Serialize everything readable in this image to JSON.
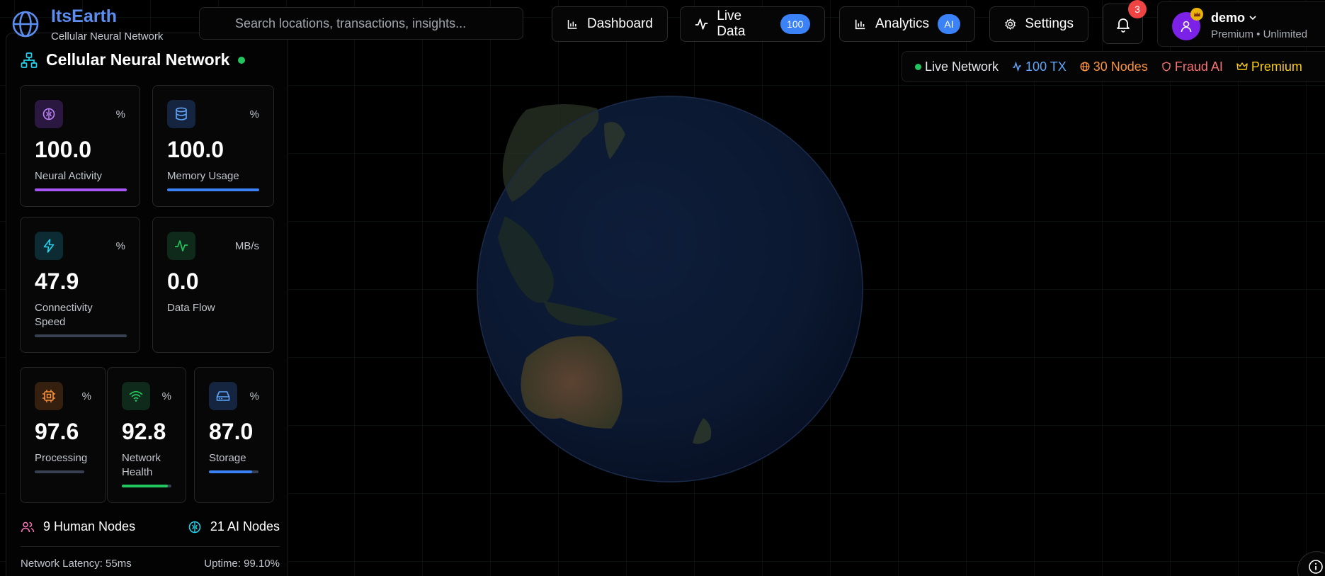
{
  "brand": {
    "title": "ItsEarth",
    "subtitle": "Cellular Neural Network"
  },
  "search": {
    "placeholder": "Search locations, transactions, insights..."
  },
  "nav": {
    "dashboard": "Dashboard",
    "live_data": {
      "label": "Live Data",
      "badge": "100"
    },
    "analytics": {
      "label": "Analytics",
      "badge": "AI"
    },
    "settings": "Settings"
  },
  "notifications": {
    "count": "3"
  },
  "user": {
    "name": "demo",
    "plan": "Premium • Unlimited"
  },
  "sidebar": {
    "title": "Cellular Neural Network",
    "cards": [
      {
        "value": "100.0",
        "unit": "%",
        "label": "Neural Activity",
        "level": 1.0,
        "color": "#a855f7",
        "icon": "brain-icon"
      },
      {
        "value": "100.0",
        "unit": "%",
        "label": "Memory Usage",
        "level": 1.0,
        "color": "#3b82f6",
        "icon": "database-icon"
      },
      {
        "value": "47.9",
        "unit": "%",
        "label": "Connectivity Speed",
        "level": 0.0,
        "color": "#22d3ee",
        "icon": "zap-icon"
      },
      {
        "value": "0.0",
        "unit": "MB/s",
        "label": "Data Flow",
        "level": 0.0,
        "color": "#22c55e",
        "icon": "activity-icon"
      },
      {
        "value": "97.6",
        "unit": "%",
        "label": "Processing",
        "level": 0.0,
        "color": "#f97316",
        "icon": "cpu-icon"
      },
      {
        "value": "92.8",
        "unit": "%",
        "label": "Network Health",
        "level": 0.928,
        "color": "#22c55e",
        "icon": "wifi-icon"
      },
      {
        "value": "87.0",
        "unit": "%",
        "label": "Storage",
        "level": 0.87,
        "color": "#3b82f6",
        "icon": "hard-drive-icon"
      }
    ],
    "human_nodes": "9 Human Nodes",
    "ai_nodes": "21 AI Nodes",
    "latency": "Network Latency: 55ms",
    "uptime": "Uptime: 99.10%"
  },
  "status": {
    "live": "Live Network",
    "tx": "100 TX",
    "nodes": "30 Nodes",
    "fraud": "Fraud AI",
    "premium": "Premium"
  },
  "colors": {
    "accent": "#5b8ef0",
    "live": "#22c55e",
    "tx": "#60a5fa",
    "nodes": "#fb923c",
    "fraud": "#f87171",
    "premium": "#facc15"
  }
}
